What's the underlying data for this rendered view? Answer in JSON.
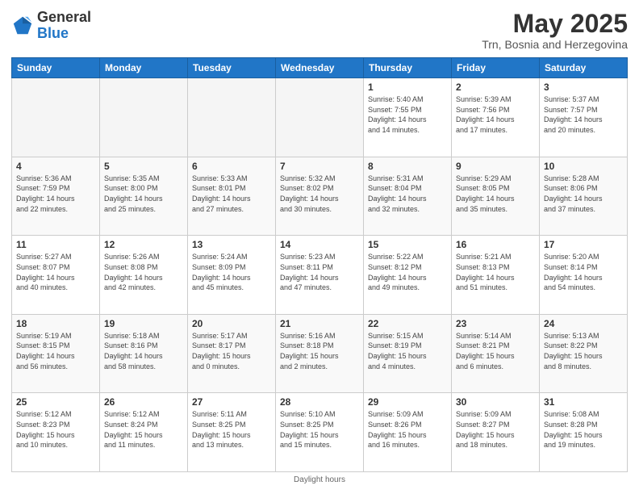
{
  "logo": {
    "general": "General",
    "blue": "Blue"
  },
  "title": "May 2025",
  "location": "Trn, Bosnia and Herzegovina",
  "days_of_week": [
    "Sunday",
    "Monday",
    "Tuesday",
    "Wednesday",
    "Thursday",
    "Friday",
    "Saturday"
  ],
  "footer": "Daylight hours",
  "weeks": [
    [
      {
        "day": "",
        "info": ""
      },
      {
        "day": "",
        "info": ""
      },
      {
        "day": "",
        "info": ""
      },
      {
        "day": "",
        "info": ""
      },
      {
        "day": "1",
        "info": "Sunrise: 5:40 AM\nSunset: 7:55 PM\nDaylight: 14 hours\nand 14 minutes."
      },
      {
        "day": "2",
        "info": "Sunrise: 5:39 AM\nSunset: 7:56 PM\nDaylight: 14 hours\nand 17 minutes."
      },
      {
        "day": "3",
        "info": "Sunrise: 5:37 AM\nSunset: 7:57 PM\nDaylight: 14 hours\nand 20 minutes."
      }
    ],
    [
      {
        "day": "4",
        "info": "Sunrise: 5:36 AM\nSunset: 7:59 PM\nDaylight: 14 hours\nand 22 minutes."
      },
      {
        "day": "5",
        "info": "Sunrise: 5:35 AM\nSunset: 8:00 PM\nDaylight: 14 hours\nand 25 minutes."
      },
      {
        "day": "6",
        "info": "Sunrise: 5:33 AM\nSunset: 8:01 PM\nDaylight: 14 hours\nand 27 minutes."
      },
      {
        "day": "7",
        "info": "Sunrise: 5:32 AM\nSunset: 8:02 PM\nDaylight: 14 hours\nand 30 minutes."
      },
      {
        "day": "8",
        "info": "Sunrise: 5:31 AM\nSunset: 8:04 PM\nDaylight: 14 hours\nand 32 minutes."
      },
      {
        "day": "9",
        "info": "Sunrise: 5:29 AM\nSunset: 8:05 PM\nDaylight: 14 hours\nand 35 minutes."
      },
      {
        "day": "10",
        "info": "Sunrise: 5:28 AM\nSunset: 8:06 PM\nDaylight: 14 hours\nand 37 minutes."
      }
    ],
    [
      {
        "day": "11",
        "info": "Sunrise: 5:27 AM\nSunset: 8:07 PM\nDaylight: 14 hours\nand 40 minutes."
      },
      {
        "day": "12",
        "info": "Sunrise: 5:26 AM\nSunset: 8:08 PM\nDaylight: 14 hours\nand 42 minutes."
      },
      {
        "day": "13",
        "info": "Sunrise: 5:24 AM\nSunset: 8:09 PM\nDaylight: 14 hours\nand 45 minutes."
      },
      {
        "day": "14",
        "info": "Sunrise: 5:23 AM\nSunset: 8:11 PM\nDaylight: 14 hours\nand 47 minutes."
      },
      {
        "day": "15",
        "info": "Sunrise: 5:22 AM\nSunset: 8:12 PM\nDaylight: 14 hours\nand 49 minutes."
      },
      {
        "day": "16",
        "info": "Sunrise: 5:21 AM\nSunset: 8:13 PM\nDaylight: 14 hours\nand 51 minutes."
      },
      {
        "day": "17",
        "info": "Sunrise: 5:20 AM\nSunset: 8:14 PM\nDaylight: 14 hours\nand 54 minutes."
      }
    ],
    [
      {
        "day": "18",
        "info": "Sunrise: 5:19 AM\nSunset: 8:15 PM\nDaylight: 14 hours\nand 56 minutes."
      },
      {
        "day": "19",
        "info": "Sunrise: 5:18 AM\nSunset: 8:16 PM\nDaylight: 14 hours\nand 58 minutes."
      },
      {
        "day": "20",
        "info": "Sunrise: 5:17 AM\nSunset: 8:17 PM\nDaylight: 15 hours\nand 0 minutes."
      },
      {
        "day": "21",
        "info": "Sunrise: 5:16 AM\nSunset: 8:18 PM\nDaylight: 15 hours\nand 2 minutes."
      },
      {
        "day": "22",
        "info": "Sunrise: 5:15 AM\nSunset: 8:19 PM\nDaylight: 15 hours\nand 4 minutes."
      },
      {
        "day": "23",
        "info": "Sunrise: 5:14 AM\nSunset: 8:21 PM\nDaylight: 15 hours\nand 6 minutes."
      },
      {
        "day": "24",
        "info": "Sunrise: 5:13 AM\nSunset: 8:22 PM\nDaylight: 15 hours\nand 8 minutes."
      }
    ],
    [
      {
        "day": "25",
        "info": "Sunrise: 5:12 AM\nSunset: 8:23 PM\nDaylight: 15 hours\nand 10 minutes."
      },
      {
        "day": "26",
        "info": "Sunrise: 5:12 AM\nSunset: 8:24 PM\nDaylight: 15 hours\nand 11 minutes."
      },
      {
        "day": "27",
        "info": "Sunrise: 5:11 AM\nSunset: 8:25 PM\nDaylight: 15 hours\nand 13 minutes."
      },
      {
        "day": "28",
        "info": "Sunrise: 5:10 AM\nSunset: 8:25 PM\nDaylight: 15 hours\nand 15 minutes."
      },
      {
        "day": "29",
        "info": "Sunrise: 5:09 AM\nSunset: 8:26 PM\nDaylight: 15 hours\nand 16 minutes."
      },
      {
        "day": "30",
        "info": "Sunrise: 5:09 AM\nSunset: 8:27 PM\nDaylight: 15 hours\nand 18 minutes."
      },
      {
        "day": "31",
        "info": "Sunrise: 5:08 AM\nSunset: 8:28 PM\nDaylight: 15 hours\nand 19 minutes."
      }
    ]
  ]
}
